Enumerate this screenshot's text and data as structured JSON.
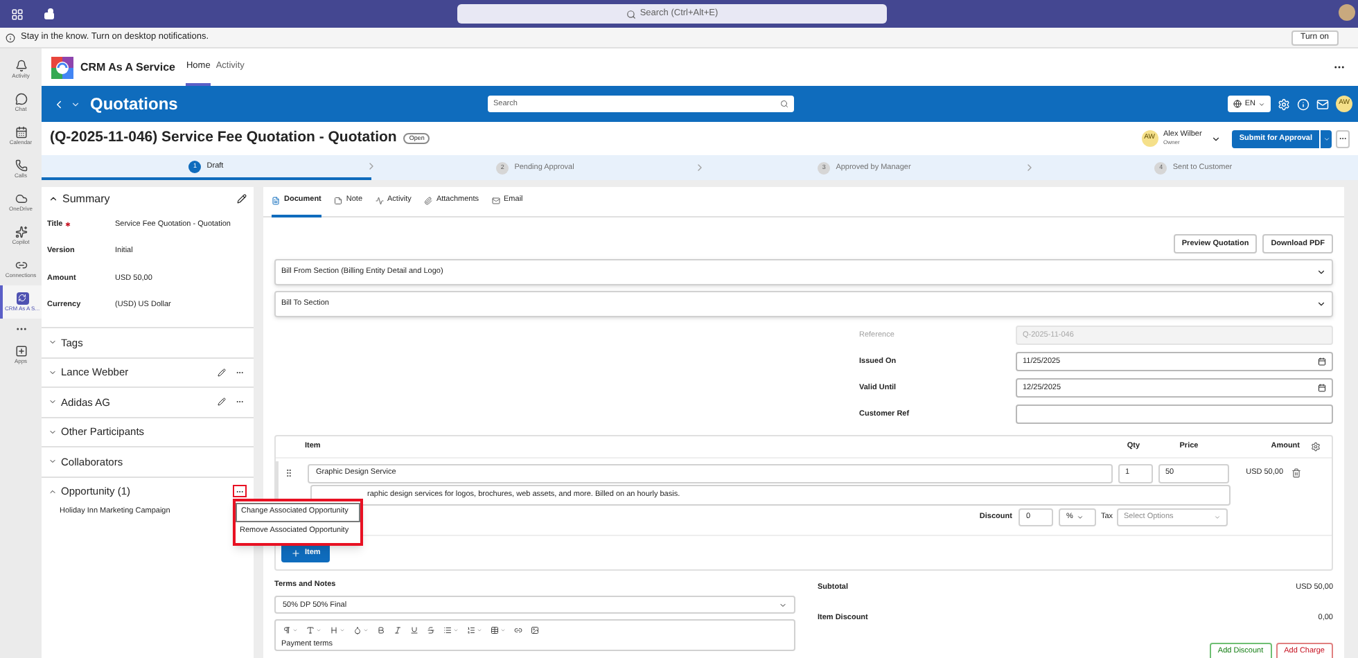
{
  "teams_bar": {
    "search_placeholder": "Search (Ctrl+Alt+E)"
  },
  "notification": {
    "text": "Stay in the know. Turn on desktop notifications.",
    "button": "Turn on"
  },
  "rail": [
    {
      "label": "Activity",
      "kind": "bell",
      "selected": false
    },
    {
      "label": "Chat",
      "kind": "chat",
      "selected": false
    },
    {
      "label": "Calendar",
      "kind": "calendar",
      "selected": false
    },
    {
      "label": "Calls",
      "kind": "phone",
      "selected": false
    },
    {
      "label": "OneDrive",
      "kind": "cloud",
      "selected": false
    },
    {
      "label": "Copilot",
      "kind": "copilot",
      "selected": false
    },
    {
      "label": "Connections",
      "kind": "link",
      "selected": false
    },
    {
      "label": "CRM As A S...",
      "kind": "app",
      "selected": true
    }
  ],
  "rail_apps": {
    "label": "Apps"
  },
  "app": {
    "name": "CRM As A Service",
    "tabs": [
      {
        "label": "Home",
        "selected": true
      },
      {
        "label": "Activity",
        "selected": false
      }
    ]
  },
  "header": {
    "title": "Quotations",
    "search_placeholder": "Search",
    "language": "EN",
    "avatar": "AW"
  },
  "record": {
    "title": "(Q-2025-11-046) Service Fee Quotation - Quotation",
    "status": "Open",
    "owner": {
      "initials": "AW",
      "name": "Alex Wilber",
      "role": "Owner"
    },
    "primary_action": "Submit for Approval"
  },
  "steps": [
    {
      "number": "1",
      "label": "Draft",
      "selected": true
    },
    {
      "number": "2",
      "label": "Pending Approval",
      "selected": false
    },
    {
      "number": "3",
      "label": "Approved by Manager",
      "selected": false
    },
    {
      "number": "4",
      "label": "Sent to Customer",
      "selected": false
    }
  ],
  "summary": {
    "title": "Summary",
    "expanded": true,
    "fields": [
      {
        "label": "Title",
        "required": true,
        "value": "Service Fee Quotation - Quotation"
      },
      {
        "label": "Version",
        "required": false,
        "value": "Initial"
      },
      {
        "label": "Amount",
        "required": false,
        "value": "USD 50,00"
      },
      {
        "label": "Currency",
        "required": false,
        "value": "(USD) US Dollar"
      }
    ]
  },
  "sections": [
    {
      "title": "Tags",
      "expanded": false,
      "edit": false,
      "more": false,
      "highlighted": false
    },
    {
      "title": "Lance Webber",
      "expanded": false,
      "edit": true,
      "more": true,
      "highlighted": false
    },
    {
      "title": "Adidas AG",
      "expanded": false,
      "edit": true,
      "more": true,
      "highlighted": false
    },
    {
      "title": "Other Participants",
      "expanded": false,
      "edit": false,
      "more": false,
      "highlighted": false
    },
    {
      "title": "Collaborators",
      "expanded": false,
      "edit": false,
      "more": false,
      "highlighted": false
    },
    {
      "title": "Opportunity (1)",
      "expanded": true,
      "edit": false,
      "more": true,
      "highlighted": true,
      "items": [
        "Holiday Inn Marketing Campaign"
      ]
    }
  ],
  "context_menu": {
    "items": [
      "Change Associated Opportunity",
      "Remove Associated Opportunity"
    ]
  },
  "doc_tabs": [
    {
      "label": "Document",
      "kind": "document",
      "selected": true
    },
    {
      "label": "Note",
      "kind": "note",
      "selected": false
    },
    {
      "label": "Activity",
      "kind": "activity",
      "selected": false
    },
    {
      "label": "Attachments",
      "kind": "attachment",
      "selected": false
    },
    {
      "label": "Email",
      "kind": "email",
      "selected": false
    }
  ],
  "doc_buttons": [
    "Preview Quotation",
    "Download PDF"
  ],
  "accordions": [
    {
      "title": "Bill From Section (Billing Entity Detail and Logo)",
      "expanded": false
    },
    {
      "title": "Bill To Section",
      "expanded": false
    }
  ],
  "form": [
    {
      "label": "Reference",
      "kind": "text",
      "value": "Q-2025-11-046",
      "disabled": true
    },
    {
      "label": "Issued On",
      "kind": "date",
      "value": "11/25/2025",
      "disabled": false
    },
    {
      "label": "Valid Until",
      "kind": "date",
      "value": "12/25/2025",
      "disabled": false
    },
    {
      "label": "Customer Ref",
      "kind": "text",
      "disabled": false
    }
  ],
  "items_table": {
    "columns": [
      "Item",
      "Qty",
      "Price",
      "Amount"
    ],
    "rows": [
      {
        "item": "Graphic Design Service",
        "qty": "1",
        "price": "50",
        "amount": "USD 50,00",
        "description": "raphic design services for logos, brochures, web assets, and more. Billed on an hourly basis.",
        "discount_label": "Discount",
        "discount": "0",
        "discount_unit": "%",
        "tax_label": "Tax",
        "tax_placeholder": "Select Options"
      }
    ],
    "add_button": "Item"
  },
  "terms": {
    "label": "Terms and Notes",
    "value": "50% DP 50% Final",
    "body": "Payment terms"
  },
  "totals": [
    {
      "label": "Subtotal",
      "value": "USD 50,00"
    },
    {
      "label": "Item Discount",
      "value": "0,00"
    }
  ],
  "total_buttons": [
    {
      "label": "Add Discount",
      "kind": "discount"
    },
    {
      "label": "Add Charge",
      "kind": "charge"
    }
  ]
}
